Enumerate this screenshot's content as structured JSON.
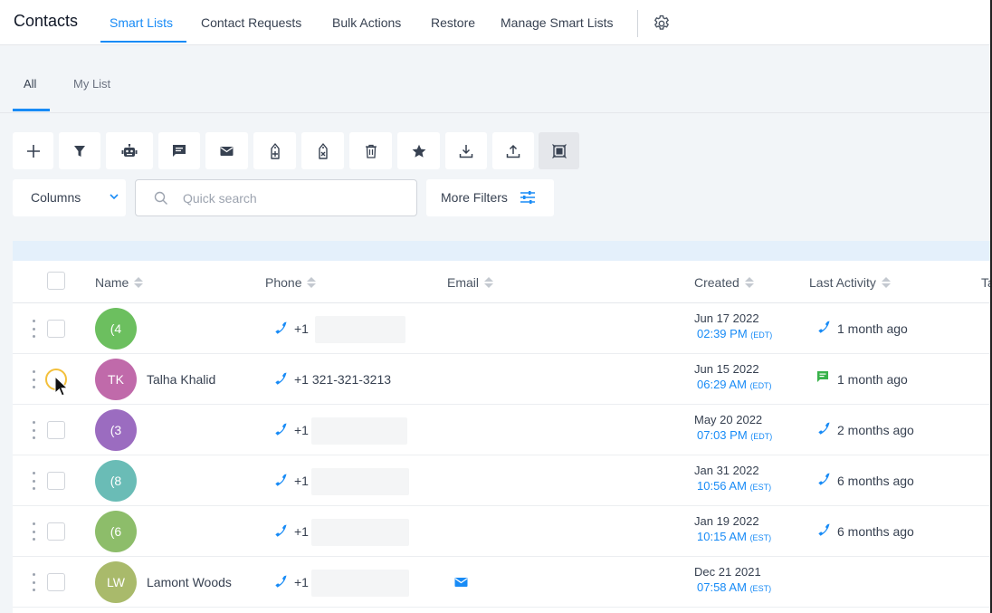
{
  "header": {
    "title": "Contacts",
    "tabs": [
      {
        "label": "Smart Lists",
        "active": true
      },
      {
        "label": "Contact Requests",
        "active": false
      },
      {
        "label": "Bulk Actions",
        "active": false
      },
      {
        "label": "Restore",
        "active": false
      },
      {
        "label": "Manage Smart Lists",
        "active": false
      }
    ],
    "settings_icon": "gear-icon"
  },
  "subtabs": [
    {
      "label": "All",
      "active": true
    },
    {
      "label": "My List",
      "active": false
    }
  ],
  "toolbar": {
    "buttons": [
      {
        "icon": "plus-icon",
        "action": "add-contact"
      },
      {
        "icon": "filter-icon",
        "action": "filter"
      },
      {
        "icon": "robot-icon",
        "action": "add-to-workflow"
      },
      {
        "icon": "message-icon",
        "action": "send-sms"
      },
      {
        "icon": "email-icon",
        "action": "send-email"
      },
      {
        "icon": "tag-add-icon",
        "action": "add-tag"
      },
      {
        "icon": "tag-remove-icon",
        "action": "remove-tag"
      },
      {
        "icon": "trash-icon",
        "action": "delete"
      },
      {
        "icon": "star-icon",
        "action": "review-request"
      },
      {
        "icon": "download-icon",
        "action": "export"
      },
      {
        "icon": "upload-icon",
        "action": "import"
      },
      {
        "icon": "merge-icon",
        "action": "merge",
        "selected": true
      }
    ],
    "columns_label": "Columns",
    "search_placeholder": "Quick search",
    "more_filters_label": "More Filters"
  },
  "table": {
    "columns": [
      "Name",
      "Phone",
      "Email",
      "Created",
      "Last Activity",
      "Ta"
    ],
    "rows": [
      {
        "initials": "(4",
        "avatar_color": "#6cbf5f",
        "name": "",
        "phone": "+1",
        "email_icon": false,
        "created_date": "Jun 17 2022",
        "created_time": "02:39 PM",
        "tz": "(EDT)",
        "activity_icon": "phone-icon",
        "activity": "1 month ago"
      },
      {
        "initials": "TK",
        "avatar_color": "#c06aaa",
        "name": "Talha Khalid",
        "phone": "+1 321-321-3213",
        "email_icon": false,
        "created_date": "Jun 15 2022",
        "created_time": "06:29 AM",
        "tz": "(EDT)",
        "activity_icon": "sms-icon",
        "activity": "1 month ago"
      },
      {
        "initials": "(3",
        "avatar_color": "#9b6cc0",
        "name": "",
        "phone": "+1",
        "email_icon": false,
        "created_date": "May 20 2022",
        "created_time": "07:03 PM",
        "tz": "(EDT)",
        "activity_icon": "phone-icon",
        "activity": "2 months ago"
      },
      {
        "initials": "(8",
        "avatar_color": "#6abcb6",
        "name": "",
        "phone": "+1",
        "email_icon": false,
        "created_date": "Jan 31 2022",
        "created_time": "10:56 AM",
        "tz": "(EST)",
        "activity_icon": "phone-icon",
        "activity": "6 months ago"
      },
      {
        "initials": "(6",
        "avatar_color": "#8dbd6a",
        "name": "",
        "phone": "+1",
        "email_icon": false,
        "created_date": "Jan 19 2022",
        "created_time": "10:15 AM",
        "tz": "(EST)",
        "activity_icon": "phone-icon",
        "activity": "6 months ago"
      },
      {
        "initials": "LW",
        "avatar_color": "#a9ba6b",
        "name": "Lamont Woods",
        "phone": "+1",
        "email_icon": true,
        "created_date": "Dec 21 2021",
        "created_time": "07:58 AM",
        "tz": "(EST)",
        "activity_icon": "",
        "activity": ""
      }
    ]
  },
  "colors": {
    "accent": "#188bf6",
    "sms": "#38b24a",
    "focus": "#f3c03b"
  }
}
